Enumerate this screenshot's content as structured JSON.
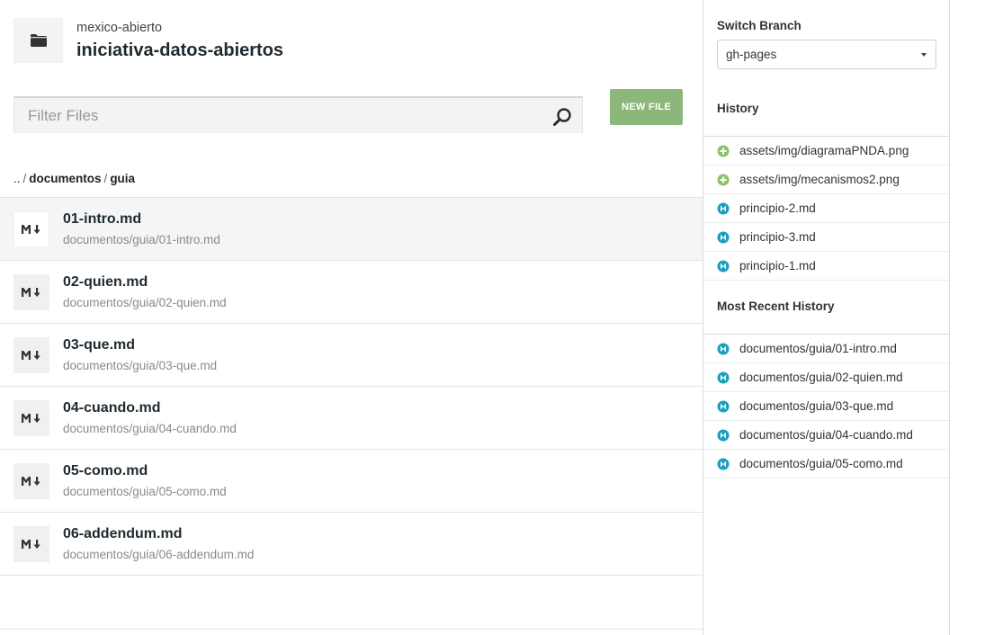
{
  "repo": {
    "owner": "mexico-abierto",
    "name": "iniciativa-datos-abiertos"
  },
  "filter": {
    "placeholder": "Filter Files",
    "value": ""
  },
  "toolbar": {
    "new_file_label": "NEW FILE"
  },
  "breadcrumb": {
    "up": "..",
    "separator": "/",
    "items": [
      "documentos",
      "guia"
    ]
  },
  "files": [
    {
      "name": "01-intro.md",
      "path": "documentos/guia/01-intro.md",
      "icon": "markdown-icon",
      "active": true
    },
    {
      "name": "02-quien.md",
      "path": "documentos/guia/02-quien.md",
      "icon": "markdown-icon"
    },
    {
      "name": "03-que.md",
      "path": "documentos/guia/03-que.md",
      "icon": "markdown-icon"
    },
    {
      "name": "04-cuando.md",
      "path": "documentos/guia/04-cuando.md",
      "icon": "markdown-icon"
    },
    {
      "name": "05-como.md",
      "path": "documentos/guia/05-como.md",
      "icon": "markdown-icon"
    },
    {
      "name": "06-addendum.md",
      "path": "documentos/guia/06-addendum.md",
      "icon": "markdown-icon"
    }
  ],
  "sidebar": {
    "switch_branch_label": "Switch Branch",
    "branch_selected": "gh-pages",
    "history_label": "History",
    "history": [
      {
        "path": "assets/img/diagramaPNDA.png",
        "status": "added",
        "icon": "added-icon"
      },
      {
        "path": "assets/img/mecanismos2.png",
        "status": "added",
        "icon": "added-icon"
      },
      {
        "path": "principio-2.md",
        "status": "modified",
        "icon": "modified-icon"
      },
      {
        "path": "principio-3.md",
        "status": "modified",
        "icon": "modified-icon"
      },
      {
        "path": "principio-1.md",
        "status": "modified",
        "icon": "modified-icon"
      }
    ],
    "recent_label": "Most Recent History",
    "recent": [
      {
        "path": "documentos/guia/01-intro.md",
        "status": "modified",
        "icon": "modified-icon"
      },
      {
        "path": "documentos/guia/02-quien.md",
        "status": "modified",
        "icon": "modified-icon"
      },
      {
        "path": "documentos/guia/03-que.md",
        "status": "modified",
        "icon": "modified-icon"
      },
      {
        "path": "documentos/guia/04-cuando.md",
        "status": "modified",
        "icon": "modified-icon"
      },
      {
        "path": "documentos/guia/05-como.md",
        "status": "modified",
        "icon": "modified-icon"
      }
    ]
  },
  "colors": {
    "accent_green": "#8cb77a",
    "added": "#8cc26b",
    "modified": "#1a9fbe"
  }
}
